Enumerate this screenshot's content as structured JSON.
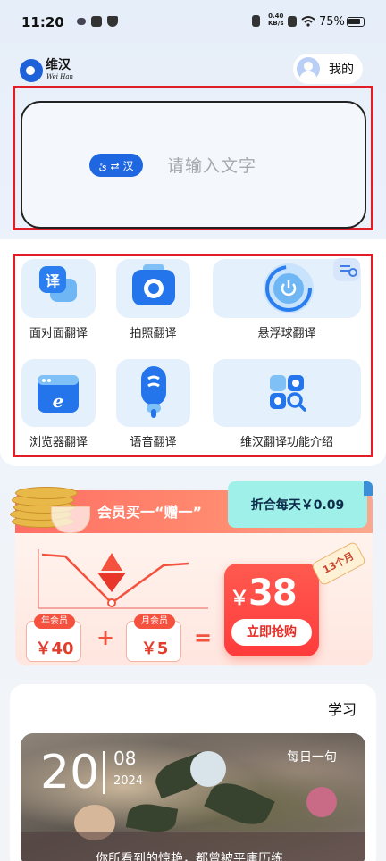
{
  "status_bar": {
    "time": "11:20",
    "net_speed": "0.40",
    "net_unit": "KB/s",
    "battery": "75%"
  },
  "header": {
    "logo_text": "维汉",
    "logo_sub": "Wei Han",
    "me_label": "我的"
  },
  "input": {
    "lang_pill": "ئ ⇄ 汉",
    "placeholder": "请输入文字"
  },
  "tools": [
    {
      "label": "面对面翻译",
      "icon": "face-to-face-translate-icon"
    },
    {
      "label": "拍照翻译",
      "icon": "camera-icon"
    },
    {
      "label": "悬浮球翻译",
      "icon": "floating-ball-icon"
    },
    {
      "label": "浏览器翻译",
      "icon": "browser-icon"
    },
    {
      "label": "语音翻译",
      "icon": "microphone-icon"
    },
    {
      "label": "维汉翻译功能介绍",
      "icon": "apps-grid-icon"
    }
  ],
  "promo": {
    "title": "会员买一“赠一”",
    "daily_price": "折合每天￥0.09",
    "year_label": "年会员",
    "year_price": "￥40",
    "month_label": "月会员",
    "month_price": "￥5",
    "plus": "+",
    "equals": "=",
    "total_currency": "￥",
    "total_price": "38",
    "buy_button": "立即抢购",
    "duration": "13个月"
  },
  "study": {
    "title": "学习",
    "day": "20",
    "month": "08",
    "year": "2024",
    "daily_label": "每日一句",
    "quote": "你所看到的惊艳，都曾被平庸历练"
  },
  "colors": {
    "accent": "#1f67e0",
    "highlight": "#e01e26",
    "promo_red": "#ff3b3b"
  }
}
